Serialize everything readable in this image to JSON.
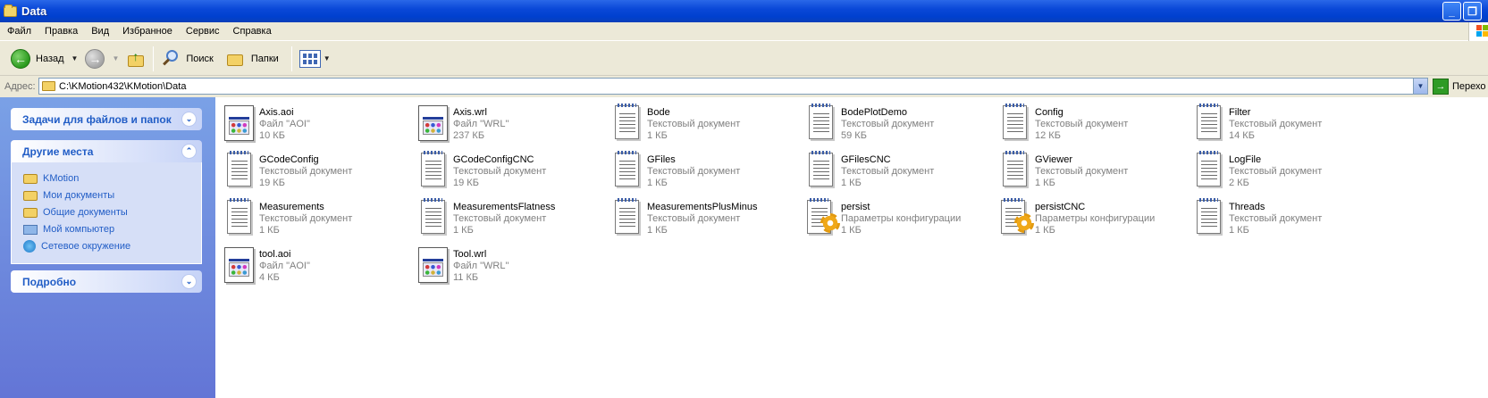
{
  "window": {
    "title": "Data",
    "minimize_glyph": "_",
    "restore_glyph": "❐",
    "close_glyph": "✕"
  },
  "menu": [
    "Файл",
    "Правка",
    "Вид",
    "Избранное",
    "Сервис",
    "Справка"
  ],
  "toolbar": {
    "back_label": "Назад",
    "search_label": "Поиск",
    "folders_label": "Папки"
  },
  "address": {
    "label": "Адрес:",
    "path": "C:\\KMotion432\\KMotion\\Data",
    "go_label": "Перехо"
  },
  "left_pane": {
    "tasks_title": "Задачи для файлов и папок",
    "places_title": "Другие места",
    "places": [
      "KMotion",
      "Мои документы",
      "Общие документы",
      "Мой компьютер",
      "Сетевое окружение"
    ],
    "details_title": "Подробно"
  },
  "files": [
    {
      "name": "Axis.aoi",
      "type": "Файл \"AOI\"",
      "size": "10 КБ",
      "icon": "aoi"
    },
    {
      "name": "Axis.wrl",
      "type": "Файл \"WRL\"",
      "size": "237 КБ",
      "icon": "wrl"
    },
    {
      "name": "Bode",
      "type": "Текстовый документ",
      "size": "1 КБ",
      "icon": "txt"
    },
    {
      "name": "BodePlotDemo",
      "type": "Текстовый документ",
      "size": "59 КБ",
      "icon": "txt"
    },
    {
      "name": "Config",
      "type": "Текстовый документ",
      "size": "12 КБ",
      "icon": "txt"
    },
    {
      "name": "Filter",
      "type": "Текстовый документ",
      "size": "14 КБ",
      "icon": "txt"
    },
    {
      "name": "GCodeConfig",
      "type": "Текстовый документ",
      "size": "19 КБ",
      "icon": "txt"
    },
    {
      "name": "GCodeConfigCNC",
      "type": "Текстовый документ",
      "size": "19 КБ",
      "icon": "txt"
    },
    {
      "name": "GFiles",
      "type": "Текстовый документ",
      "size": "1 КБ",
      "icon": "txt"
    },
    {
      "name": "GFilesCNC",
      "type": "Текстовый документ",
      "size": "1 КБ",
      "icon": "txt"
    },
    {
      "name": "GViewer",
      "type": "Текстовый документ",
      "size": "1 КБ",
      "icon": "txt"
    },
    {
      "name": "LogFile",
      "type": "Текстовый документ",
      "size": "2 КБ",
      "icon": "txt"
    },
    {
      "name": "Measurements",
      "type": "Текстовый документ",
      "size": "1 КБ",
      "icon": "txt"
    },
    {
      "name": "MeasurementsFlatness",
      "type": "Текстовый документ",
      "size": "1 КБ",
      "icon": "txt"
    },
    {
      "name": "MeasurementsPlusMinus",
      "type": "Текстовый документ",
      "size": "1 КБ",
      "icon": "txt"
    },
    {
      "name": "persist",
      "type": "Параметры конфигурации",
      "size": "1 КБ",
      "icon": "config"
    },
    {
      "name": "persistCNC",
      "type": "Параметры конфигурации",
      "size": "1 КБ",
      "icon": "config"
    },
    {
      "name": "Threads",
      "type": "Текстовый документ",
      "size": "1 КБ",
      "icon": "txt"
    },
    {
      "name": "tool.aoi",
      "type": "Файл \"AOI\"",
      "size": "4 КБ",
      "icon": "aoi"
    },
    {
      "name": "Tool.wrl",
      "type": "Файл \"WRL\"",
      "size": "11 КБ",
      "icon": "wrl"
    }
  ]
}
